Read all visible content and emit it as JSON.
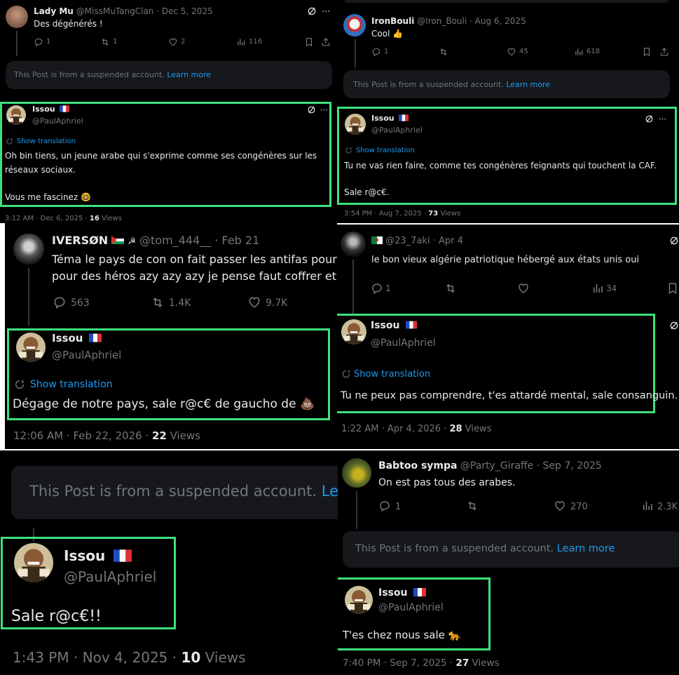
{
  "p1": {
    "parent": {
      "name": "Lady Mu",
      "handle": "@MissMuTangClan",
      "date": "Dec 5, 2025",
      "text": "Des dégénérés !",
      "replies": "1",
      "reposts": "1",
      "likes": "2",
      "views": "116"
    },
    "suspended": {
      "text": "This Post is from a suspended account.",
      "link": "Learn more"
    },
    "reply": {
      "name": "Issou",
      "handle": "@PaulAphriel",
      "translate": "Show translation",
      "line1": "Oh bin tiens, un jeune arabe qui s'exprime comme ses congénères sur les",
      "line2": "réseaux sociaux.",
      "line3": "Vous me fascinez 🤓",
      "time": "3:12 AM · Dec 6, 2025 · ",
      "views_count": "16",
      "views_label": "Views"
    }
  },
  "p2": {
    "parent": {
      "name": "IronBouli",
      "handle": "@Iron_Bouli",
      "date": "Aug 6, 2025",
      "text": "Cool 👍",
      "replies": "1",
      "likes": "45",
      "views": "618"
    },
    "suspended": {
      "text": "This Post is from a suspended account.",
      "link": "Learn more"
    },
    "reply": {
      "name": "Issou",
      "handle": "@PaulAphriel",
      "translate": "Show translation",
      "line1": "Tu ne vas rien faire, comme tes congénères feignants qui touchent la CAF.",
      "line2": "Sale r@c€.",
      "time": "3:54 PM · Aug 7, 2025 · ",
      "views_count": "73",
      "views_label": "Views"
    }
  },
  "p3": {
    "parent": {
      "name": "IVERSØN",
      "handle": "@tom_444__",
      "date": "Feb 21",
      "line1": "Téma le pays de con on fait passer les antifas pour d",
      "line2": "pour des héros azy azy azy je pense faut coffrer et se",
      "replies": "563",
      "reposts": "1.4K",
      "likes": "9.7K"
    },
    "reply": {
      "name": "Issou",
      "handle": "@PaulAphriel",
      "translate": "Show translation",
      "text": "Dégage de notre pays, sale r@c€ de gaucho de 💩",
      "time": "12:06 AM · Feb 22, 2026 · ",
      "views_count": "22",
      "views_label": "Views"
    }
  },
  "p4": {
    "parent": {
      "handle": "@23_7aki",
      "date": "Apr 4",
      "text": "le bon vieux algérie patriotique hébergé aux états unis oui",
      "replies": "1",
      "views": "34"
    },
    "reply": {
      "name": "Issou",
      "handle": "@PaulAphriel",
      "translate": "Show translation",
      "text": "Tu ne peux pas comprendre, t'es attardé mental, sale consanguin.",
      "time": "1:22 AM · Apr 4, 2026 · ",
      "views_count": "28",
      "views_label": "Views"
    }
  },
  "p5": {
    "suspended": {
      "text": "This Post is from a suspended account.",
      "link": "Lear"
    },
    "reply": {
      "name": "Issou",
      "handle": "@PaulAphriel",
      "text": "Sale r@c€!!",
      "time": "1:43 PM · Nov 4, 2025 · ",
      "views_count": "10",
      "views_label": "Views"
    }
  },
  "p6": {
    "parent": {
      "name": "Babtoo sympa",
      "handle": "@Party_Giraffe",
      "date": "Sep 7, 2025",
      "text": "On est pas tous des arabes.",
      "replies": "1",
      "likes": "270",
      "views": "2.3K"
    },
    "suspended": {
      "text": "This Post is from a suspended account.",
      "link": "Learn more"
    },
    "reply": {
      "name": "Issou",
      "handle": "@PaulAphriel",
      "text": "T'es chez nous sale 🐆",
      "time": "7:40 PM · Sep 7, 2025 · ",
      "views_count": "27",
      "views_label": "Views"
    }
  },
  "colors": {
    "highlight": "#3ee07c",
    "link": "#1d9bf0",
    "muted": "#71767b",
    "text": "#e7e9ea"
  }
}
